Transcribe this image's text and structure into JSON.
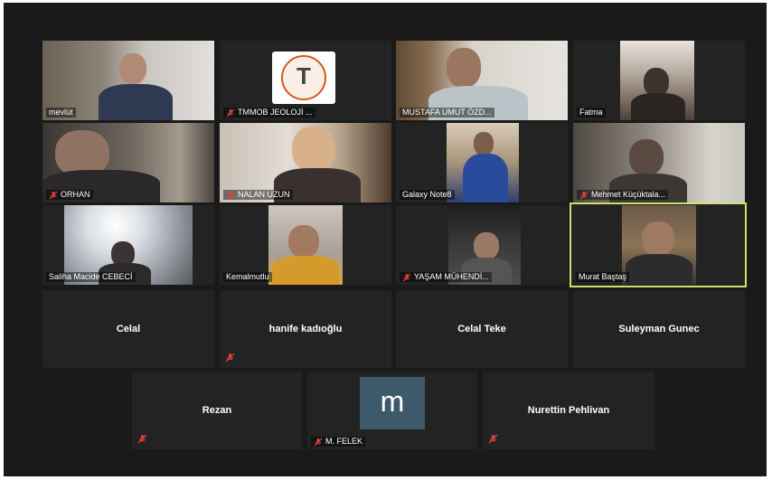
{
  "tiles": [
    {
      "name": "mevlüt",
      "muted": false
    },
    {
      "name": "TMMOB JEOLOJİ ...",
      "muted": true
    },
    {
      "name": "MUSTAFA UMUT ÖZD...",
      "muted": false
    },
    {
      "name": "Fatma",
      "muted": false
    },
    {
      "name": "ORHAN",
      "muted": true
    },
    {
      "name": "NALAN UZUN",
      "muted": true
    },
    {
      "name": "Galaxy Note8",
      "muted": false
    },
    {
      "name": "Mehmet Küçüktala...",
      "muted": true
    },
    {
      "name": "Saliha Macide CEBECİ",
      "muted": false
    },
    {
      "name": "Kemalmutlu",
      "muted": false
    },
    {
      "name": "YAŞAM MÜHENDİ...",
      "muted": true
    },
    {
      "name": "Murat Baştaş",
      "muted": false,
      "active": true
    },
    {
      "name": "Celal",
      "muted": false
    },
    {
      "name": "hanife kadıoğlu",
      "muted": true
    },
    {
      "name": "Celal Teke",
      "muted": false
    },
    {
      "name": "Suleyman Gunec",
      "muted": false
    },
    {
      "name": "Rezan",
      "muted": true
    },
    {
      "name": "M. FELEK",
      "muted": true,
      "avatar_letter": "m"
    },
    {
      "name": "Nurettin Pehlivan",
      "muted": true
    }
  ],
  "colors": {
    "background": "#1a1a1a",
    "tile": "#232323",
    "active_speaker": "#c9e36a",
    "muted_icon": "#e0403a",
    "avatar": "#3c5a6b"
  }
}
